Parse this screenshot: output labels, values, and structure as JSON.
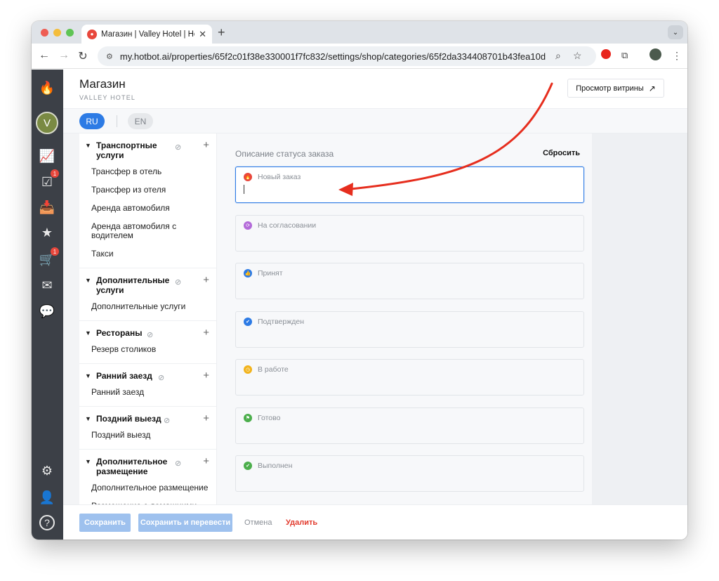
{
  "browser": {
    "tab_title": "Магазин | Valley Hotel | Hotbot",
    "tab_close": "✕",
    "new_tab": "+",
    "tab_menu": "⌄",
    "url": "my.hotbot.ai/properties/65f2c01f38e330001f7fc832/settings/shop/categories/65f2da334408701b43fea10d",
    "back": "←",
    "forward": "→",
    "reload": "↻",
    "site_info": "⚙",
    "zoom": "⌕",
    "bookmark": "☆",
    "menu": "⋮"
  },
  "rail": {
    "logo": "🔥",
    "avatar_letter": "V",
    "badges": {
      "tasks": "1",
      "orders": "1"
    },
    "icons": {
      "analytics": "📈",
      "tasks": "☑",
      "inbox": "📥",
      "reviews": "★",
      "cart": "🛒",
      "mail": "✉",
      "chat": "💬",
      "settings": "⚙",
      "profile": "👤",
      "help": "?"
    }
  },
  "header": {
    "title": "Магазин",
    "subtitle": "VALLEY HOTEL",
    "showcase_label": "Просмотр витрины",
    "showcase_arrow": "↗"
  },
  "languages": {
    "active": "RU",
    "other": "EN"
  },
  "categories": [
    {
      "title": "Транспортные услуги",
      "items": [
        "Трансфер в отель",
        "Трансфер из отеля",
        "Аренда автомобиля",
        "Аренда автомобиля с водителем",
        "Такси"
      ]
    },
    {
      "title": "Дополнительные услуги",
      "items": [
        "Дополнительные услуги"
      ]
    },
    {
      "title": "Рестораны",
      "items": [
        "Резерв столиков"
      ]
    },
    {
      "title": "Ранний заезд",
      "items": [
        "Ранний заезд"
      ]
    },
    {
      "title": "Поздний выезд",
      "items": [
        "Поздний выезд"
      ]
    },
    {
      "title": "Дополнительное размещение",
      "items": [
        "Дополнительное размещение",
        "Размещение с домашними"
      ]
    }
  ],
  "category_controls": {
    "caret": "▼",
    "hide_icon": "⊘",
    "add": "+"
  },
  "content": {
    "section_label": "Описание статуса заказа",
    "reset_label": "Сбросить",
    "statuses": [
      {
        "name": "Новый заказ",
        "color": "#e8473c",
        "glyph": "🔥"
      },
      {
        "name": "На согласовании",
        "color": "#b36ad9",
        "glyph": "⟳"
      },
      {
        "name": "Принят",
        "color": "#2d7be5",
        "glyph": "👍"
      },
      {
        "name": "Подтвержден",
        "color": "#2d7be5",
        "glyph": "✔"
      },
      {
        "name": "В работе",
        "color": "#f2b31b",
        "glyph": "◷"
      },
      {
        "name": "Готово",
        "color": "#4cae4c",
        "glyph": "⚑"
      },
      {
        "name": "Выполнен",
        "color": "#4cae4c",
        "glyph": "✔"
      }
    ]
  },
  "footer": {
    "save": "Сохранить",
    "save_translate": "Сохранить и перевести",
    "cancel": "Отмена",
    "delete": "Удалить"
  },
  "colors": {
    "accent": "#2d7be5",
    "danger": "#e23b2e",
    "rail": "#3c4047",
    "annotation": "#e62e1e"
  }
}
